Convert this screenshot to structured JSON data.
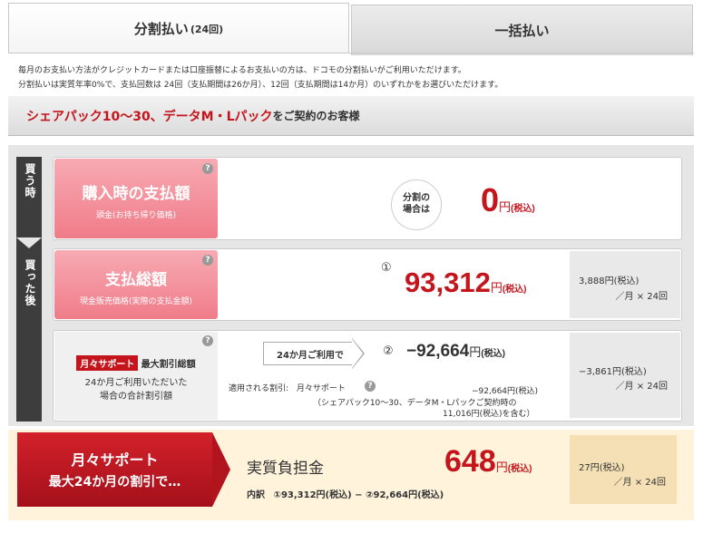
{
  "tabs": {
    "installment_label": "分割払い",
    "installment_count": "(24回)",
    "lump_sum_label": "一括払い"
  },
  "notes": {
    "line1": "毎月のお支払い方法がクレジットカードまたは口座振替によるお支払いの方は、ドコモの分割払いがご利用いただけます。",
    "line2": "分割払いは実質年率0%で、支払回数は 24回（支払期間は26か月）、12回（支払期間は14か月）のいずれかをお選びいただけます。"
  },
  "banner": {
    "highlight": "シェアパック10〜30、データM・Lパック",
    "rest": "をご契約のお客様"
  },
  "side_labels": {
    "purchase_time": "買う時",
    "after_purchase": "買った後"
  },
  "row_purchase": {
    "title": "購入時の支払額",
    "subtitle": "頭金(お持ち帰り価格)",
    "circle_text_1": "分割の",
    "circle_text_2": "場合は",
    "amount": "0",
    "unit": "円",
    "tax": "(税込)"
  },
  "row_total": {
    "title": "支払総額",
    "subtitle": "現金販売価格(実際の支払金額)",
    "marker": "①",
    "amount": "93,312",
    "unit": "円",
    "tax": "(税込)",
    "monthly": "3,888円",
    "monthly_tax": "(税込)",
    "monthly_suffix": "／月 × 24回"
  },
  "row_support": {
    "badge": "月々サポート",
    "title": "最大割引総額",
    "desc_1": "24か月ご利用いただいた",
    "desc_2": "場合の合計割引額",
    "arrow_label": "24か月ご利用で",
    "marker": "②",
    "amount": "−92,664",
    "unit": "円",
    "tax": "(税込)",
    "applied_label": "適用される割引:",
    "applied_name": "月々サポート",
    "applied_amount": "−92,664円(税込)",
    "applied_note_1": "（シェアパック10～30、データM・Lパックご契約時の",
    "applied_note_2": "11,016円(税込)を含む）",
    "monthly": "−3,861円",
    "monthly_tax": "(税込)",
    "monthly_suffix": "／月 × 24回"
  },
  "row_effective": {
    "flag_line1": "月々サポート",
    "flag_line2": "最大24か月の割引で…",
    "label": "実質負担金",
    "amount": "648",
    "unit": "円",
    "tax": "(税込)",
    "breakdown_label": "内訳",
    "breakdown": "①93,312円(税込) − ②92,664円(税込)",
    "monthly": "27円",
    "monthly_tax": "(税込)",
    "monthly_suffix": "／月 × 24回"
  },
  "help_icon": "?",
  "colors": {
    "accent_red": "#c4151c",
    "pink": "#f07c89"
  }
}
